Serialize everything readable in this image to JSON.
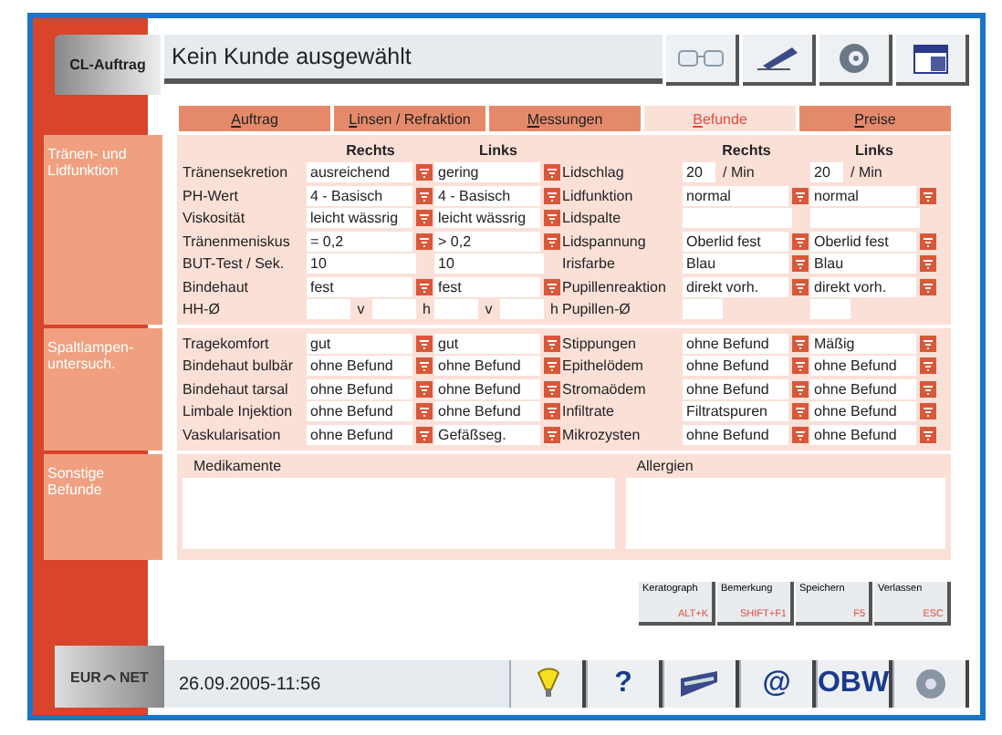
{
  "header": {
    "badge": "CL-Auftrag",
    "title": "Kein Kunde ausgewählt",
    "tools": [
      {
        "kind": "glasses"
      },
      {
        "kind": "pen"
      },
      {
        "kind": "disc"
      },
      {
        "kind": "calendar"
      }
    ]
  },
  "tabs": [
    {
      "label": "Auftrag",
      "selected": false
    },
    {
      "label": "Linsen / Refraktion",
      "selected": false
    },
    {
      "label": "Messungen",
      "selected": false
    },
    {
      "label": "Befunde",
      "selected": true
    },
    {
      "label": "Preise",
      "selected": false
    }
  ],
  "sections": [
    {
      "label": "Tränen- und Lidfunktion",
      "halves": [
        {
          "columns": [
            "Rechts",
            "Links"
          ],
          "rows": [
            {
              "label": "Tränensekretion",
              "kind": "field",
              "right": {
                "value": "ausreichend",
                "dropdown": true
              },
              "left": {
                "value": "gering",
                "dropdown": true
              }
            },
            {
              "label": "PH-Wert",
              "kind": "field",
              "right": {
                "value": "4 - Basisch",
                "dropdown": true
              },
              "left": {
                "value": "4 - Basisch",
                "dropdown": true
              }
            },
            {
              "label": "Viskosität",
              "kind": "field",
              "right": {
                "value": "leicht wässrig",
                "dropdown": true
              },
              "left": {
                "value": "leicht wässrig",
                "dropdown": true
              }
            },
            {
              "label": "Tränenmeniskus",
              "kind": "field",
              "right": {
                "value": "= 0,2",
                "dropdown": true
              },
              "left": {
                "value": "> 0,2",
                "dropdown": true
              }
            },
            {
              "label": "BUT-Test / Sek.",
              "kind": "field",
              "right": {
                "value": "10",
                "dropdown": false
              },
              "left": {
                "value": "10",
                "dropdown": false
              }
            },
            {
              "label": "Bindehaut",
              "kind": "field",
              "right": {
                "value": "fest",
                "dropdown": true
              },
              "left": {
                "value": "fest",
                "dropdown": true
              }
            },
            {
              "label": "HH-Ø",
              "kind": "pair",
              "right": {
                "parts": [
                  "v",
                  "h"
                ]
              },
              "left": {
                "parts": [
                  "v",
                  "h"
                ]
              }
            }
          ]
        },
        {
          "columns": [
            "Rechts",
            "Links"
          ],
          "rows": [
            {
              "label": "Lidschlag",
              "kind": "rate",
              "right": {
                "value": "20",
                "unit": "/ Min"
              },
              "left": {
                "value": "20",
                "unit": "/ Min"
              }
            },
            {
              "label": "Lidfunktion",
              "kind": "field",
              "right": {
                "value": "normal",
                "dropdown": true
              },
              "left": {
                "value": "normal",
                "dropdown": true
              }
            },
            {
              "label": "Lidspalte",
              "kind": "blank"
            },
            {
              "label": "Lidspannung",
              "kind": "field",
              "right": {
                "value": "Oberlid fest",
                "dropdown": true
              },
              "left": {
                "value": "Oberlid fest",
                "dropdown": true
              }
            },
            {
              "label": "Irisfarbe",
              "kind": "field",
              "right": {
                "value": "Blau",
                "dropdown": true
              },
              "left": {
                "value": "Blau",
                "dropdown": true
              }
            },
            {
              "label": "Pupillenreaktion",
              "kind": "field",
              "right": {
                "value": "direkt vorh.",
                "dropdown": true
              },
              "left": {
                "value": "direkt vorh.",
                "dropdown": true
              }
            },
            {
              "label": "Pupillen-Ø",
              "kind": "short"
            }
          ]
        }
      ]
    },
    {
      "label": "Spaltlampen- untersuch.",
      "halves": [
        {
          "rows": [
            {
              "label": "Tragekomfort",
              "kind": "field",
              "right": {
                "value": "gut",
                "dropdown": true
              },
              "left": {
                "value": "gut",
                "dropdown": true
              }
            },
            {
              "label": "Bindehaut bulbär",
              "kind": "field",
              "right": {
                "value": "ohne Befund",
                "dropdown": true
              },
              "left": {
                "value": "ohne Befund",
                "dropdown": true
              }
            },
            {
              "label": "Bindehaut tarsal",
              "kind": "field",
              "right": {
                "value": "ohne Befund",
                "dropdown": true
              },
              "left": {
                "value": "ohne Befund",
                "dropdown": true
              }
            },
            {
              "label": "Limbale Injektion",
              "kind": "field",
              "right": {
                "value": "ohne Befund",
                "dropdown": true
              },
              "left": {
                "value": "ohne Befund",
                "dropdown": true
              }
            },
            {
              "label": "Vaskularisation",
              "kind": "field",
              "right": {
                "value": "ohne Befund",
                "dropdown": true
              },
              "left": {
                "value": "Gefäßseg.",
                "dropdown": true
              }
            }
          ]
        },
        {
          "rows": [
            {
              "label": "Stippungen",
              "kind": "field",
              "right": {
                "value": "ohne Befund",
                "dropdown": true
              },
              "left": {
                "value": "Mäßig",
                "dropdown": true
              }
            },
            {
              "label": "Epithelödem",
              "kind": "field",
              "right": {
                "value": "ohne Befund",
                "dropdown": true
              },
              "left": {
                "value": "ohne Befund",
                "dropdown": true
              }
            },
            {
              "label": "Stromaödem",
              "kind": "field",
              "right": {
                "value": "ohne Befund",
                "dropdown": true
              },
              "left": {
                "value": "ohne Befund",
                "dropdown": true
              }
            },
            {
              "label": "Infiltrate",
              "kind": "field",
              "right": {
                "value": "Filtratspuren",
                "dropdown": true
              },
              "left": {
                "value": "ohne Befund",
                "dropdown": true
              }
            },
            {
              "label": "Mikrozysten",
              "kind": "field",
              "right": {
                "value": "ohne Befund",
                "dropdown": true
              },
              "left": {
                "value": "ohne Befund",
                "dropdown": true
              }
            }
          ]
        }
      ]
    }
  ],
  "other": {
    "label": "Sonstige Befunde",
    "notes": [
      {
        "label": "Medikamente"
      },
      {
        "label": "Allergien"
      }
    ]
  },
  "actions": [
    {
      "label": "Keratograph",
      "key": "ALT+K"
    },
    {
      "label": "Bemerkung",
      "key": "SHIFT+F1"
    },
    {
      "label": "Speichern",
      "key": "F5"
    },
    {
      "label": "Verlassen",
      "key": "ESC"
    }
  ],
  "footer": {
    "logo": [
      "EUR",
      "NET"
    ],
    "datetime": "26.09.2005-11:56",
    "tools": [
      {
        "kind": "bulb"
      },
      {
        "kind": "text",
        "label": "?"
      },
      {
        "kind": "pen"
      },
      {
        "kind": "text",
        "label": "@"
      },
      {
        "kind": "text",
        "label": "OBW"
      },
      {
        "kind": "disc"
      }
    ]
  }
}
